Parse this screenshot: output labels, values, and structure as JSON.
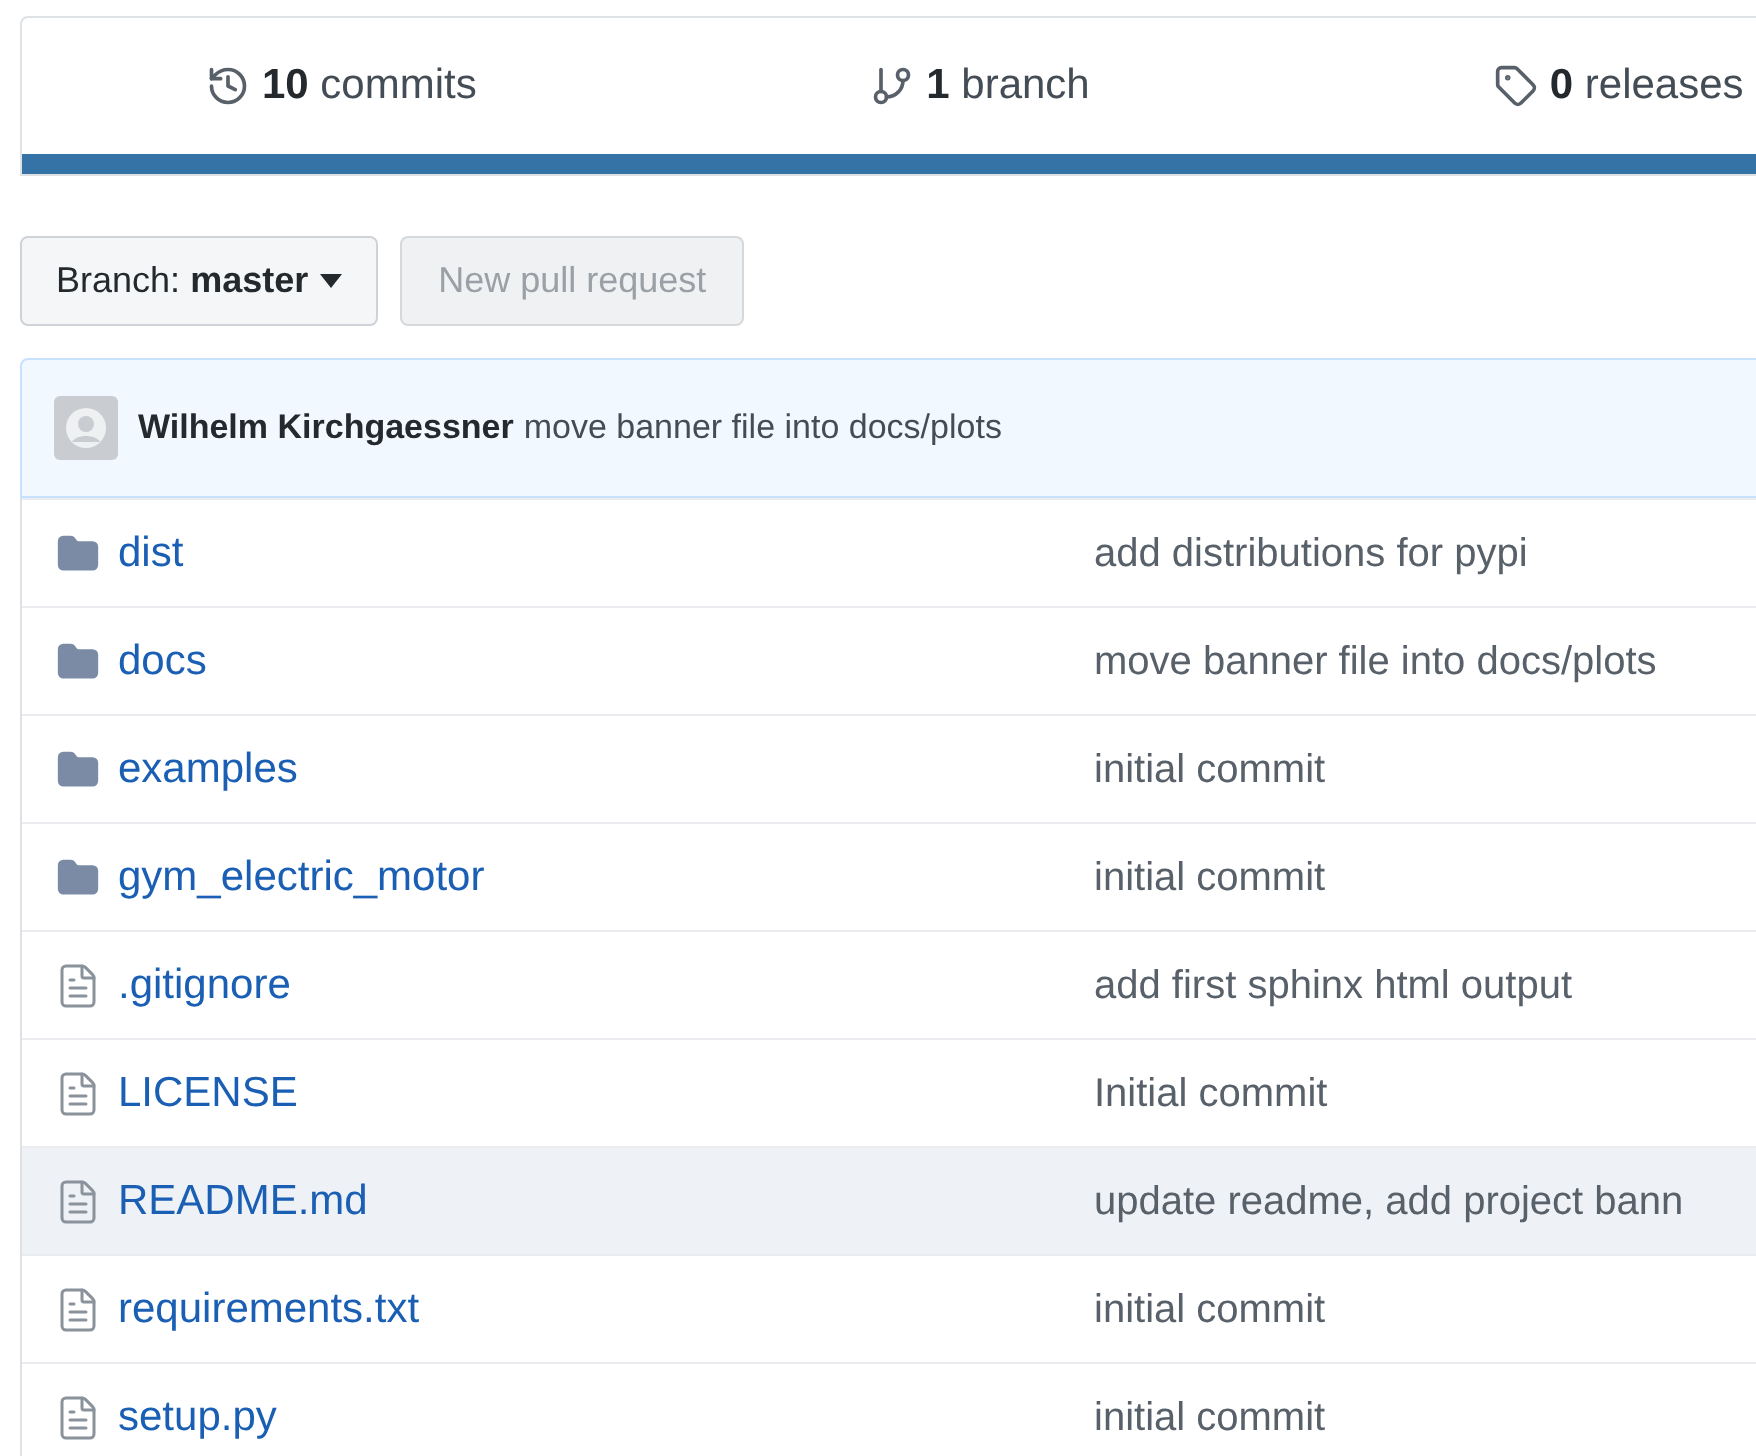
{
  "stats": [
    {
      "kind": "commits",
      "count": "10",
      "label": "commits"
    },
    {
      "kind": "branches",
      "count": "1",
      "label": "branch"
    },
    {
      "kind": "releases",
      "count": "0",
      "label": "releases"
    }
  ],
  "branch_button": {
    "label": "Branch:",
    "value": "master"
  },
  "pull_request_button": {
    "label": "New pull request",
    "disabled": true
  },
  "latest_commit": {
    "author": "Wilhelm Kirchgaessner",
    "message": "move banner file into docs/plots"
  },
  "files": [
    {
      "kind": "folder",
      "name": "dist",
      "message": "add distributions for pypi",
      "highlighted": false
    },
    {
      "kind": "folder",
      "name": "docs",
      "message": "move banner file into docs/plots",
      "highlighted": false
    },
    {
      "kind": "folder",
      "name": "examples",
      "message": "initial commit",
      "highlighted": false
    },
    {
      "kind": "folder",
      "name": "gym_electric_motor",
      "message": "initial commit",
      "highlighted": false
    },
    {
      "kind": "file",
      "name": ".gitignore",
      "message": "add first sphinx html output",
      "highlighted": false
    },
    {
      "kind": "file",
      "name": "LICENSE",
      "message": "Initial commit",
      "highlighted": false
    },
    {
      "kind": "file",
      "name": "README.md",
      "message": "update readme, add project bann",
      "highlighted": true
    },
    {
      "kind": "file",
      "name": "requirements.txt",
      "message": "initial commit",
      "highlighted": false
    },
    {
      "kind": "file",
      "name": "setup.py",
      "message": "initial commit",
      "highlighted": false
    }
  ]
}
